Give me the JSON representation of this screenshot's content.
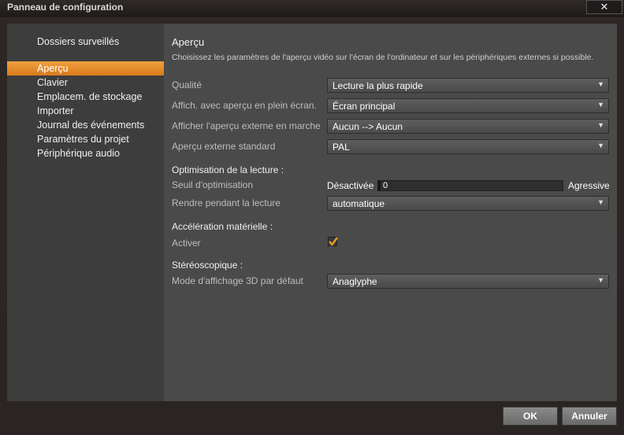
{
  "window": {
    "title": "Panneau de configuration",
    "close_glyph": "✕"
  },
  "sidebar": {
    "header": "Dossiers surveillés",
    "items": [
      {
        "label": "Aperçu",
        "selected": true
      },
      {
        "label": "Clavier"
      },
      {
        "label": "Emplacem. de stockage"
      },
      {
        "label": "Importer"
      },
      {
        "label": "Journal des événements"
      },
      {
        "label": "Paramètres du projet"
      },
      {
        "label": "Périphérique audio"
      }
    ]
  },
  "content": {
    "heading": "Aperçu",
    "description": "Choisissez les paramètres de l'aperçu vidéo sur l'écran de l'ordinateur et sur les périphériques externes si possible.",
    "quality": {
      "label": "Qualité",
      "value": "Lecture la plus rapide"
    },
    "fullscreen": {
      "label": "Affich. avec aperçu en plein écran.",
      "value": "Écran principal"
    },
    "external_on": {
      "label": "Afficher l'aperçu externe en marche",
      "value": "Aucun --> Aucun"
    },
    "external_std": {
      "label": "Aperçu externe standard",
      "value": "PAL"
    },
    "playback_section": "Optimisation de la lecture :",
    "threshold": {
      "label": "Seuil d'optimisation",
      "left": "Désactivée",
      "value": "0",
      "right": "Agressive",
      "level": 0
    },
    "render": {
      "label": "Rendre pendant la lecture",
      "value": "automatique"
    },
    "hw_section": "Accélération matérielle :",
    "activate": {
      "label": "Activer",
      "checked": true
    },
    "stereo_section": "Stéréoscopique :",
    "mode3d": {
      "label": "Mode d'affichage 3D par défaut",
      "value": "Anaglyphe"
    }
  },
  "buttons": {
    "ok": "OK",
    "cancel": "Annuler"
  },
  "icons": {
    "dropdown": "chevron-down-icon",
    "check": "checkmark-icon"
  },
  "colors": {
    "accent": "#e8891f",
    "panel": "#4a4a4a",
    "sidebar": "#3d3d3d"
  }
}
